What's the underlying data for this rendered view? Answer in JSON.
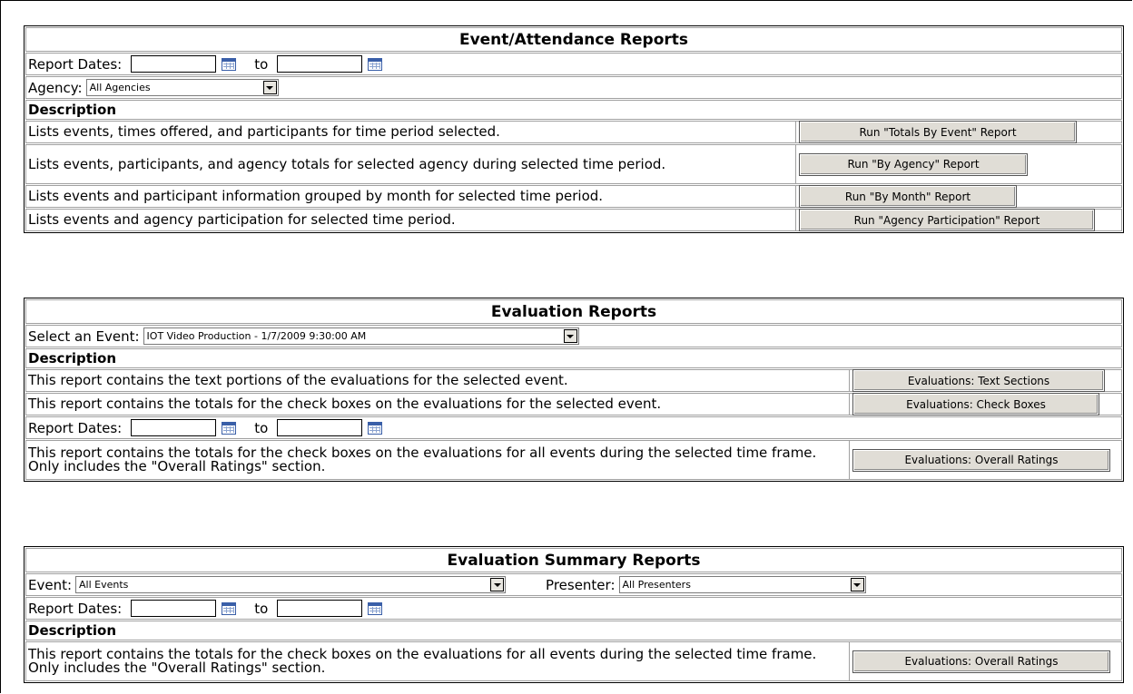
{
  "event_attendance": {
    "title": "Event/Attendance Reports",
    "report_dates_label": "Report Dates:",
    "to_label": "to",
    "start_date": "",
    "end_date": "",
    "agency_label": "Agency:",
    "agency_value": "All Agencies",
    "description_header": "Description",
    "rows": [
      {
        "description": "Lists events, times offered, and participants for time period selected.",
        "button": "Run \"Totals By Event\" Report"
      },
      {
        "description": "Lists events, participants, and agency totals for selected agency during selected time period.",
        "button": "Run \"By Agency\" Report"
      },
      {
        "description": "Lists events and participant information grouped by month for selected time period.",
        "button": "Run \"By Month\" Report"
      },
      {
        "description": "Lists events and agency participation for selected time period.",
        "button": "Run \"Agency Participation\" Report"
      }
    ]
  },
  "evaluation": {
    "title": "Evaluation Reports",
    "select_event_label": "Select an Event:",
    "select_event_value": "IOT Video Production - 1/7/2009 9:30:00 AM",
    "description_header": "Description",
    "rows": [
      {
        "description": "This report contains the text portions of the evaluations for the selected event.",
        "button": "Evaluations: Text Sections"
      },
      {
        "description": "This report contains the totals for the check boxes on the evaluations for the selected event.",
        "button": "Evaluations: Check Boxes"
      }
    ],
    "report_dates_label": "Report Dates:",
    "to_label": "to",
    "overall": {
      "description": "This report contains the totals for the check boxes on the evaluations for all events during the selected time frame. Only includes the \"Overall Ratings\" section.",
      "button": "Evaluations: Overall Ratings"
    }
  },
  "summary": {
    "title": "Evaluation Summary Reports",
    "event_label": "Event:",
    "event_value": "All Events",
    "presenter_label": "Presenter:",
    "presenter_value": "All Presenters",
    "report_dates_label": "Report Dates:",
    "to_label": "to",
    "description_header": "Description",
    "overall": {
      "description": "This report contains the totals for the check boxes on the evaluations for all events during the selected time frame. Only includes the \"Overall Ratings\" section.",
      "button": "Evaluations: Overall Ratings"
    }
  }
}
